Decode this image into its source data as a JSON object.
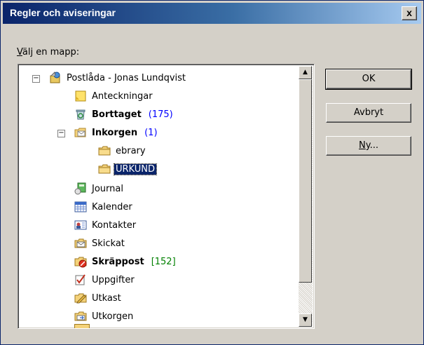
{
  "window": {
    "title": "Regler och aviseringar",
    "close_label": "x"
  },
  "folder_label": "Välj en mapp:",
  "tree": {
    "items": [
      {
        "label": "Postlåda - Jonas Lundqvist",
        "icon": "mailbox-icon"
      },
      {
        "label": "Anteckningar",
        "icon": "notes-icon"
      },
      {
        "label": "Borttaget",
        "count": "(175)",
        "icon": "trash-icon"
      },
      {
        "label": "Inkorgen",
        "count": "(1)",
        "icon": "inbox-icon"
      },
      {
        "label": "ebrary",
        "icon": "folder-icon"
      },
      {
        "label": "URKUND",
        "icon": "folder-icon",
        "selected": true
      },
      {
        "label": "Journal",
        "icon": "journal-icon"
      },
      {
        "label": "Kalender",
        "icon": "calendar-icon"
      },
      {
        "label": "Kontakter",
        "icon": "contacts-icon"
      },
      {
        "label": "Skickat",
        "icon": "sent-icon"
      },
      {
        "label": "Skräppost",
        "count": "[152]",
        "icon": "junk-icon"
      },
      {
        "label": "Uppgifter",
        "icon": "tasks-icon"
      },
      {
        "label": "Utkast",
        "icon": "drafts-icon"
      },
      {
        "label": "Utkorgen",
        "icon": "outbox-icon"
      }
    ]
  },
  "buttons": {
    "ok": "OK",
    "cancel": "Avbryt",
    "new": "Ny..."
  }
}
